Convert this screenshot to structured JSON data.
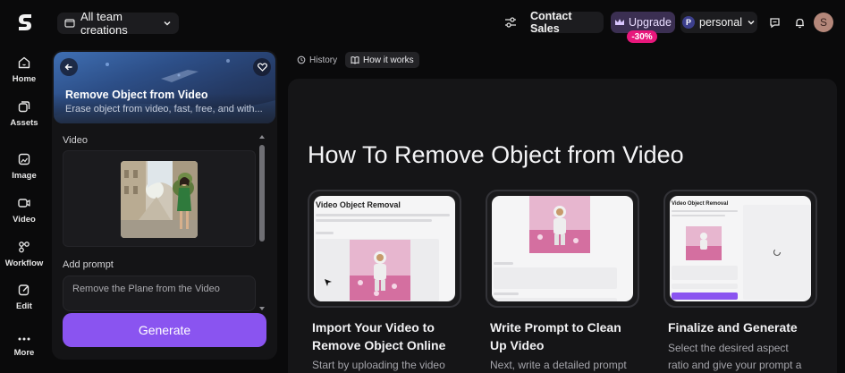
{
  "topbar": {
    "team_select": "All team creations",
    "contact_sales": "Contact Sales",
    "upgrade": "Upgrade",
    "discount": "-30%",
    "workspace_badge": "P",
    "workspace": "personal",
    "avatar_initial": "S"
  },
  "nav": {
    "items": [
      {
        "label": "Home"
      },
      {
        "label": "Assets"
      },
      {
        "label": "Image"
      },
      {
        "label": "Video"
      },
      {
        "label": "Workflow"
      },
      {
        "label": "Edit"
      },
      {
        "label": "More"
      }
    ]
  },
  "panel": {
    "title": "Remove Object from Video",
    "subtitle": "Erase object from video, fast, free, and with...",
    "video_label": "Video",
    "prompt_label": "Add prompt",
    "prompt_placeholder": "Remove the Plane from the Video",
    "generate": "Generate"
  },
  "tabs": {
    "history": "History",
    "how_it_works": "How it works"
  },
  "howto": {
    "title": "How To Remove Object from Video",
    "cards": [
      {
        "thumb_title": "Video Object Removal",
        "title_line1": "Import Your Video to",
        "title_line2": "Remove Object Online",
        "desc_line1": "Start by uploading the video"
      },
      {
        "title_line1": "Write Prompt to Clean",
        "title_line2": "Up Video",
        "desc_line1": "Next, write a detailed prompt"
      },
      {
        "thumb_title": "Video Object Removal",
        "title_line1": "Finalize and Generate",
        "desc_line1": "Select the desired aspect",
        "desc_line2": "ratio and give your prompt a"
      }
    ]
  },
  "colors": {
    "accent": "#8a54f0",
    "discount": "#e8177c",
    "upgrade_bg": "#3b2f52",
    "background": "#0a0a0b"
  }
}
